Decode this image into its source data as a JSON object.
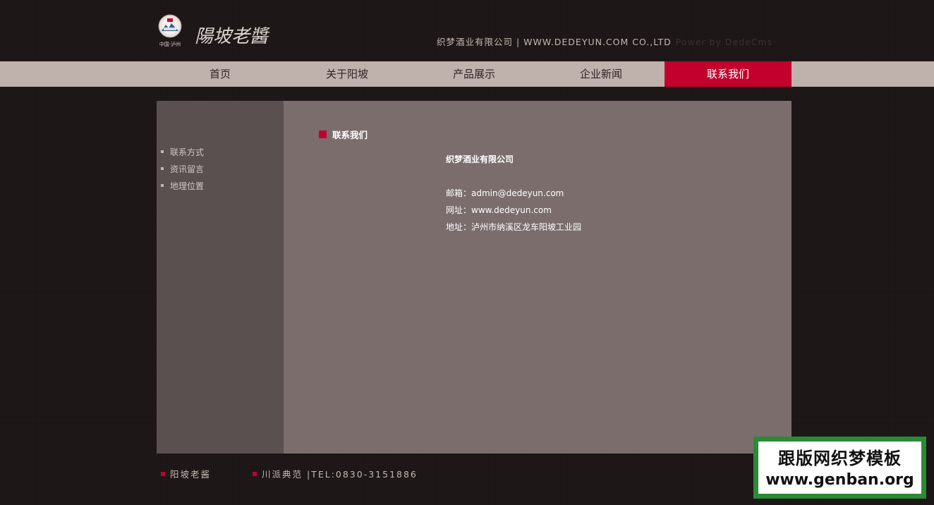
{
  "header": {
    "logo_caption": "中国·泸州",
    "logo_script_text": "陽坡老醬",
    "company_line": "织梦酒业有限公司 | WWW.DEDEYUN.COM CO.,LTD",
    "power_text": "Power by DedeCms"
  },
  "nav": {
    "items": [
      {
        "label": "首页",
        "active": false
      },
      {
        "label": "关于阳坡",
        "active": false
      },
      {
        "label": "产品展示",
        "active": false
      },
      {
        "label": "企业新闻",
        "active": false
      },
      {
        "label": "联系我们",
        "active": true
      }
    ]
  },
  "sidebar": {
    "items": [
      {
        "label": "联系方式"
      },
      {
        "label": "资讯留言"
      },
      {
        "label": "地理位置"
      }
    ]
  },
  "main": {
    "title": "联系我们",
    "company_name": "织梦酒业有限公司",
    "email_line": "邮箱：admin@dedeyun.com",
    "website_line": "网址：www.dedeyun.com",
    "address_line": "地址：泸州市纳溪区龙车阳坡工业园"
  },
  "footer": {
    "brand": "阳坡老酱",
    "slogan": "川派典范 |TEL:0830-3151886"
  },
  "watermark": {
    "line1": "跟版网织梦模板",
    "line2": "www.genban.org"
  },
  "colors": {
    "accent": "#c3002c",
    "nav_bg": "#bfb1ac",
    "sidebar_bg": "#5a504f",
    "main_bg": "#7a6d6c",
    "page_bg": "#1c1515"
  }
}
